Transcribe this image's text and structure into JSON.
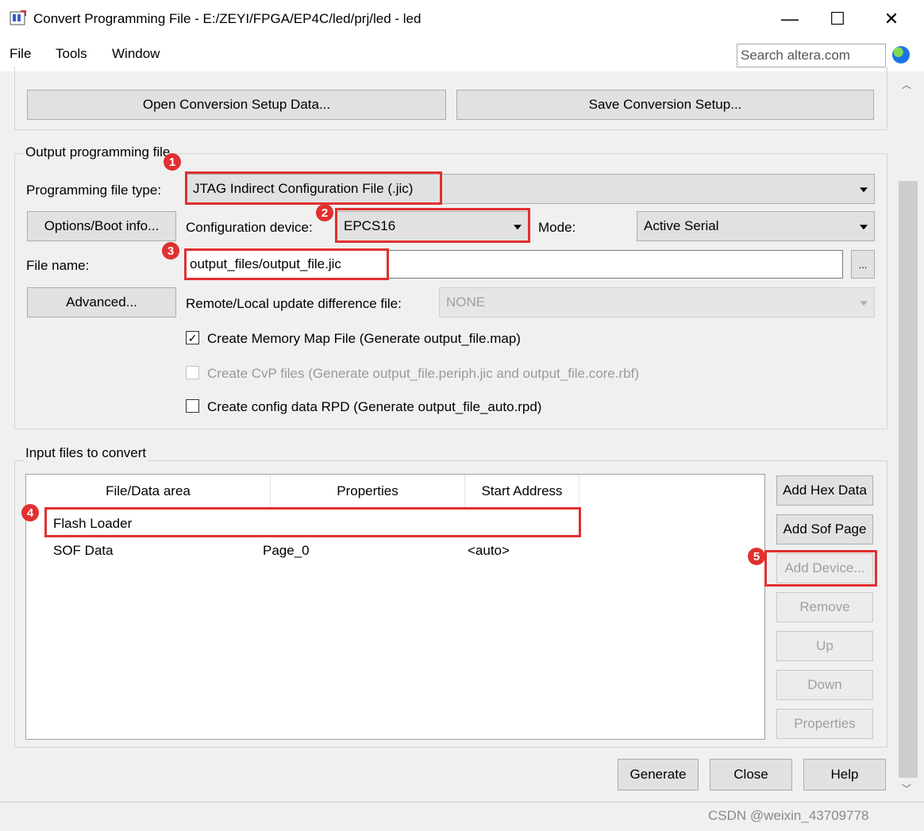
{
  "window": {
    "title": "Convert Programming File - E:/ZEYI/FPGA/EP4C/led/prj/led - led",
    "minimize": "—",
    "maximize": "☐",
    "close": "✕"
  },
  "menu": {
    "file": "File",
    "tools": "Tools",
    "window": "Window",
    "search_placeholder": "Search altera.com"
  },
  "setup": {
    "open_label": "Open Conversion Setup Data...",
    "save_label": "Save Conversion Setup..."
  },
  "output": {
    "group_label": "Output programming file",
    "file_type_label": "Programming file type:",
    "file_type_value": "JTAG Indirect Configuration File (.jic)",
    "options_button": "Options/Boot info...",
    "config_device_label": "Configuration device:",
    "config_device_value": "EPCS16",
    "mode_label": "Mode:",
    "mode_value": "Active Serial",
    "file_name_label": "File name:",
    "file_name_value": "output_files/output_file.jic",
    "browse_button": "...",
    "advanced_button": "Advanced...",
    "remote_label": "Remote/Local update difference file:",
    "remote_value": "NONE",
    "check_map": "Create Memory Map File (Generate output_file.map)",
    "check_map_mark": "✓",
    "check_cvp": "Create CvP files (Generate output_file.periph.jic and output_file.core.rbf)",
    "check_rpd": "Create config data RPD (Generate output_file_auto.rpd)"
  },
  "input": {
    "group_label": "Input files to convert",
    "columns": [
      "File/Data area",
      "Properties",
      "Start Address"
    ],
    "rows": [
      {
        "name": "Flash Loader",
        "properties": "",
        "address": ""
      },
      {
        "name": "SOF Data",
        "properties": "Page_0",
        "address": "<auto>"
      }
    ],
    "buttons": {
      "add_hex": "Add Hex Data",
      "add_sof": "Add Sof Page",
      "add_device": "Add Device...",
      "remove": "Remove",
      "up": "Up",
      "down": "Down",
      "properties": "Properties"
    }
  },
  "footer": {
    "generate": "Generate",
    "close": "Close",
    "help": "Help"
  },
  "annotations": [
    "1",
    "2",
    "3",
    "4",
    "5"
  ],
  "watermark": "CSDN @weixin_43709778",
  "colors": {
    "annotation_red": "#e03030",
    "window_bg": "#f0f0f0"
  }
}
